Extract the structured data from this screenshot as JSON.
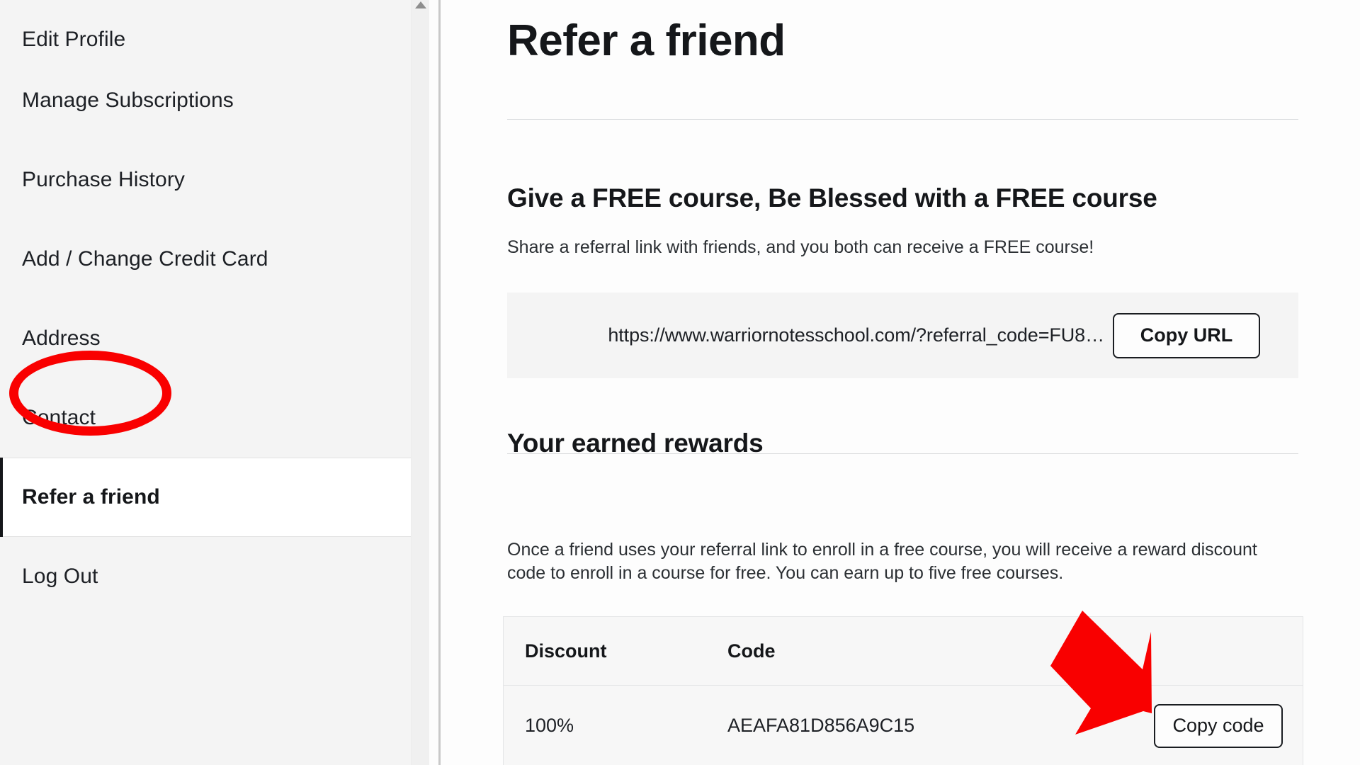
{
  "sidebar": {
    "items": [
      {
        "label": "Edit Profile",
        "active": false
      },
      {
        "label": "Manage Subscriptions",
        "active": false
      },
      {
        "label": "Purchase History",
        "active": false
      },
      {
        "label": "Add / Change Credit Card",
        "active": false
      },
      {
        "label": "Address",
        "active": false
      },
      {
        "label": "Contact",
        "active": false
      },
      {
        "label": "Refer a friend",
        "active": true
      },
      {
        "label": "Log Out",
        "active": false
      }
    ],
    "scrollbar": {
      "up_arrow_icon": "triangle-up-icon"
    }
  },
  "main": {
    "page_title": "Refer a friend",
    "give_section": {
      "heading": "Give a FREE course, Be Blessed with a FREE course",
      "description": "Share a referral link with friends, and you both can receive a FREE course!",
      "referral_url": "https://www.warriornotesschool.com/?referral_code=FU8…",
      "copy_url_label": "Copy URL"
    },
    "rewards_section": {
      "heading": "Your earned rewards",
      "description": "Once a friend uses your referral link to enroll in a free course, you will receive a reward discount code to enroll in a course for free. You can earn up to five free courses.",
      "table": {
        "columns": [
          "Discount",
          "Code"
        ],
        "rows": [
          {
            "discount": "100%",
            "code": "AEAFA81D856A9C15",
            "action_label": "Copy code"
          }
        ]
      }
    }
  },
  "annotations": {
    "highlight_color": "#f90000",
    "ellipse_target": "Refer a friend",
    "arrow_target": "Copy code"
  }
}
